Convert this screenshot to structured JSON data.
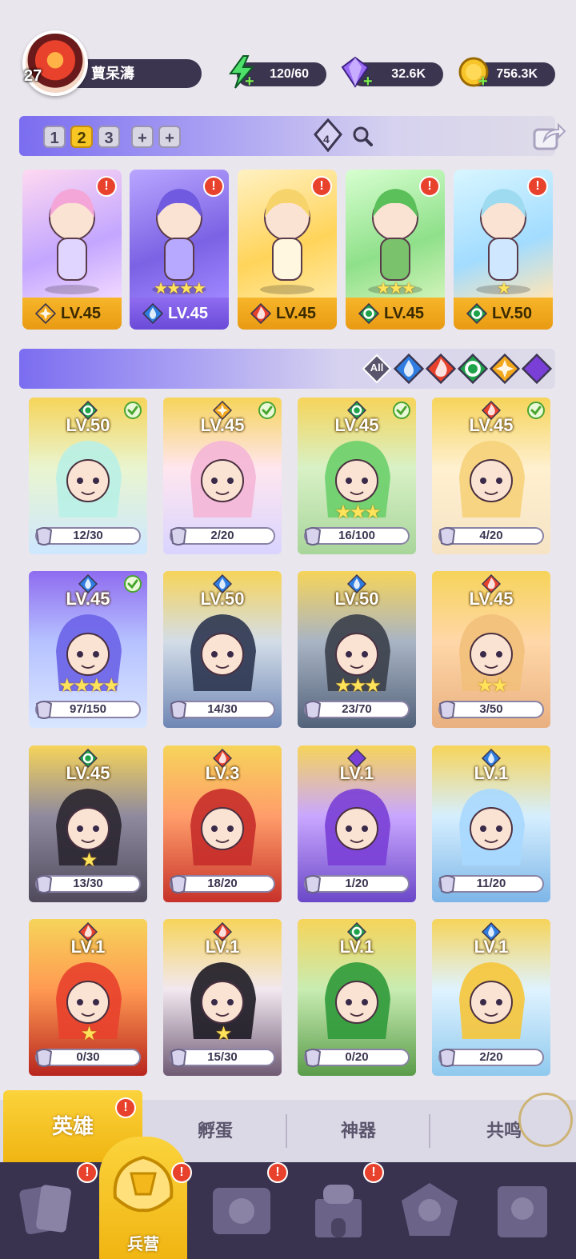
{
  "player": {
    "level": "27",
    "name": "蕒呆濤"
  },
  "resources": {
    "energy": "120/60",
    "gems": "32.6K",
    "gold": "756.3K"
  },
  "team": {
    "tabs": [
      "1",
      "2",
      "3",
      "+",
      "+"
    ],
    "active_tab": "2",
    "gem_badge": "4",
    "slots": [
      {
        "level": "LV.45",
        "element": "light",
        "stars": "",
        "theme": "gold",
        "alert": "!"
      },
      {
        "level": "LV.45",
        "element": "water",
        "stars": "★★★★",
        "theme": "purple",
        "alert": "!"
      },
      {
        "level": "LV.45",
        "element": "fire",
        "stars": "",
        "theme": "gold",
        "alert": "!"
      },
      {
        "level": "LV.45",
        "element": "wind",
        "stars": "★★★",
        "theme": "gold",
        "alert": "!"
      },
      {
        "level": "LV.50",
        "element": "wind",
        "stars": "★",
        "theme": "gold",
        "alert": "!"
      }
    ]
  },
  "filters": [
    "All",
    "water",
    "fire",
    "wind",
    "light",
    "dark"
  ],
  "heroes": [
    {
      "level": "LV.50",
      "element": "wind",
      "progress": "12/30",
      "checked": true,
      "stars": "",
      "theme": "gold"
    },
    {
      "level": "LV.45",
      "element": "light",
      "progress": "2/20",
      "checked": true,
      "stars": "",
      "theme": "gold"
    },
    {
      "level": "LV.45",
      "element": "wind",
      "progress": "16/100",
      "checked": true,
      "stars": "★★★",
      "theme": "gold"
    },
    {
      "level": "LV.45",
      "element": "fire",
      "progress": "4/20",
      "checked": true,
      "stars": "",
      "theme": "gold"
    },
    {
      "level": "LV.45",
      "element": "water",
      "progress": "97/150",
      "checked": true,
      "stars": "★★★★",
      "theme": "purple"
    },
    {
      "level": "LV.50",
      "element": "water",
      "progress": "14/30",
      "checked": false,
      "stars": "",
      "theme": "gold"
    },
    {
      "level": "LV.50",
      "element": "water",
      "progress": "23/70",
      "checked": false,
      "stars": "★★★",
      "theme": "gold"
    },
    {
      "level": "LV.45",
      "element": "fire",
      "progress": "3/50",
      "checked": false,
      "stars": "★★",
      "theme": "gold"
    },
    {
      "level": "LV.45",
      "element": "wind",
      "progress": "13/30",
      "checked": false,
      "stars": "★",
      "theme": "gold"
    },
    {
      "level": "LV.3",
      "element": "fire",
      "progress": "18/20",
      "checked": false,
      "stars": "",
      "theme": "gold"
    },
    {
      "level": "LV.1",
      "element": "dark",
      "progress": "1/20",
      "checked": false,
      "stars": "",
      "theme": "gold"
    },
    {
      "level": "LV.1",
      "element": "water",
      "progress": "11/20",
      "checked": false,
      "stars": "",
      "theme": "gold"
    },
    {
      "level": "LV.1",
      "element": "fire",
      "progress": "0/30",
      "checked": false,
      "stars": "★",
      "theme": "gold"
    },
    {
      "level": "LV.1",
      "element": "fire",
      "progress": "15/30",
      "checked": false,
      "stars": "★",
      "theme": "gold"
    },
    {
      "level": "LV.1",
      "element": "wind",
      "progress": "0/20",
      "checked": false,
      "stars": "",
      "theme": "gold"
    },
    {
      "level": "LV.1",
      "element": "water",
      "progress": "2/20",
      "checked": false,
      "stars": "",
      "theme": "gold"
    }
  ],
  "subtabs": {
    "heroes": "英雄",
    "hatch": "孵蛋",
    "artifact": "神器",
    "resonance": "共鸣",
    "alert": "!"
  },
  "nav": {
    "active_label": "兵营",
    "alert": "!"
  },
  "colors": {
    "fire": "#e8412c",
    "water": "#2f7de0",
    "wind": "#1fa34a",
    "light": "#f2a81d",
    "dark": "#7a3fd6",
    "gold_card": "#f3c12b",
    "purple_card": "#7b62e4"
  }
}
